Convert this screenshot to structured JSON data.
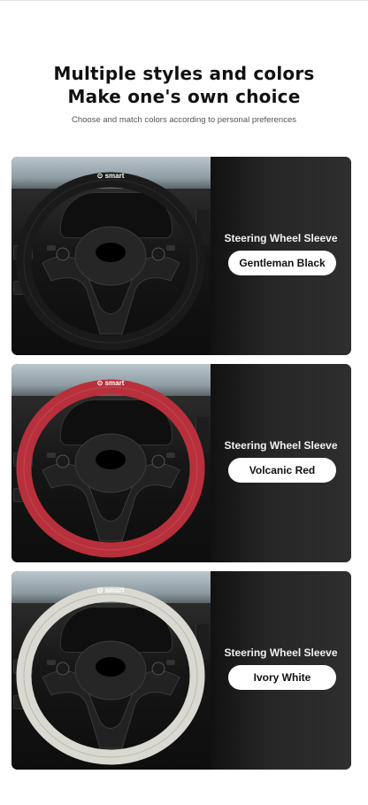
{
  "header": {
    "line1": "Multiple styles and colors",
    "line2": "Make one's own choice",
    "subtitle": "Choose and match colors according to personal preferences"
  },
  "cards": [
    {
      "label": "Steering Wheel Sleeve",
      "color_name": "Gentleman Black",
      "brand_text": "smart",
      "sleeve_color": "#1a1a1a"
    },
    {
      "label": "Steering Wheel Sleeve",
      "color_name": "Volcanic Red",
      "brand_text": "smart",
      "sleeve_color": "#b8303b"
    },
    {
      "label": "Steering Wheel Sleeve",
      "color_name": "Ivory White",
      "brand_text": "smart",
      "sleeve_color": "#d9d9d2"
    }
  ]
}
